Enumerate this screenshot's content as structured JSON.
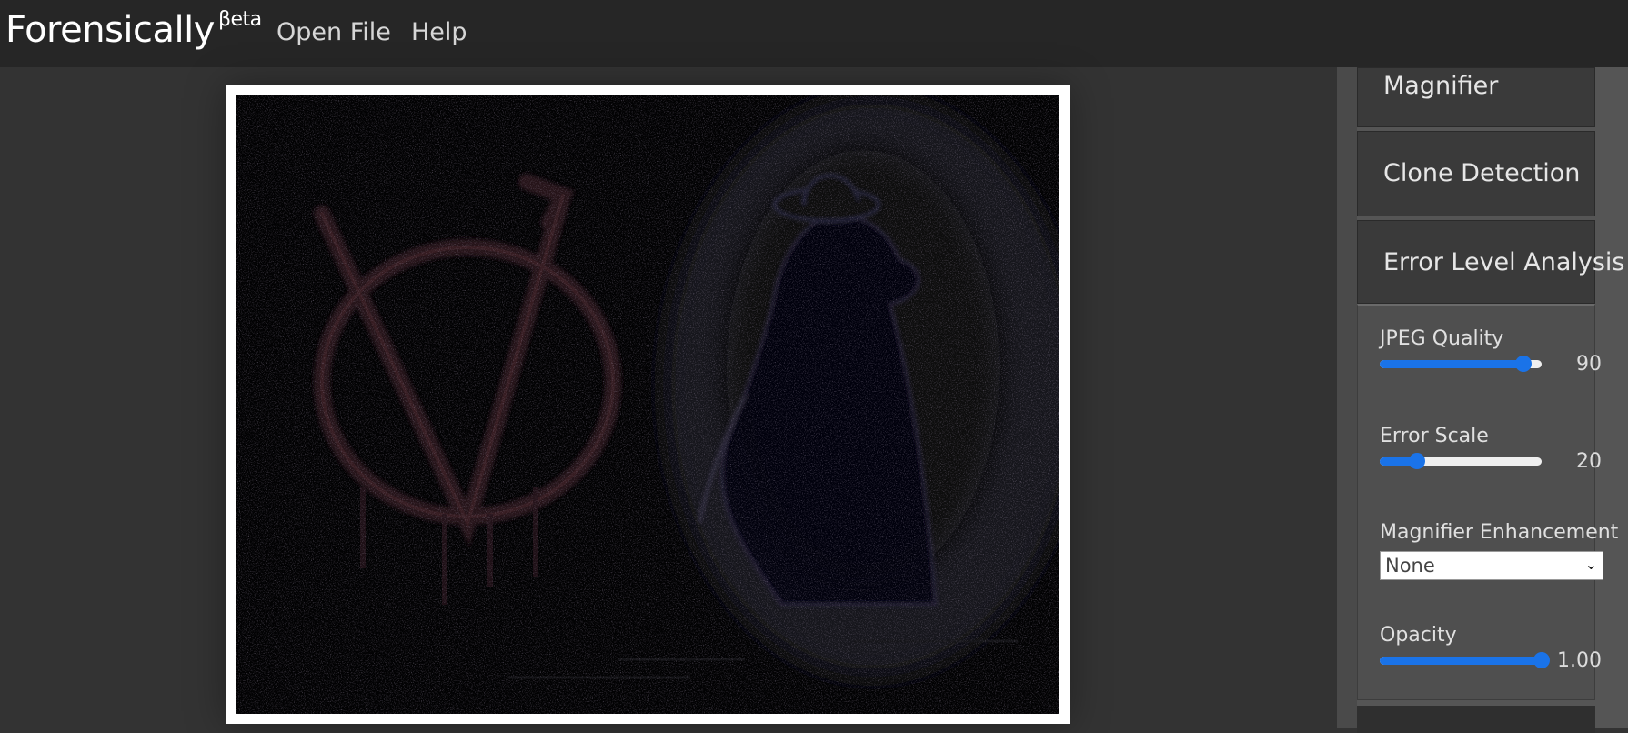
{
  "app": {
    "name": "Forensically",
    "badge": "βeta"
  },
  "nav": {
    "open_file": "Open File",
    "help": "Help"
  },
  "sidebar": {
    "panels": [
      {
        "title": "Magnifier"
      },
      {
        "title": "Clone Detection"
      },
      {
        "title": "Error Level Analysis"
      }
    ],
    "ela": {
      "jpeg_quality": {
        "label": "JPEG Quality",
        "value": "90",
        "fraction": 0.89
      },
      "error_scale": {
        "label": "Error Scale",
        "value": "20",
        "fraction": 0.23
      },
      "magnifier_enhancement": {
        "label": "Magnifier Enhancement",
        "selected": "None"
      },
      "opacity": {
        "label": "Opacity",
        "value": "1.00",
        "fraction": 1.0
      }
    }
  },
  "colors": {
    "accent": "#1a73e8",
    "topbar": "#262626",
    "workspace": "#333333",
    "panel": "#3a3a3a"
  },
  "icons": {
    "select_chevron": "chevron-down-icon"
  }
}
